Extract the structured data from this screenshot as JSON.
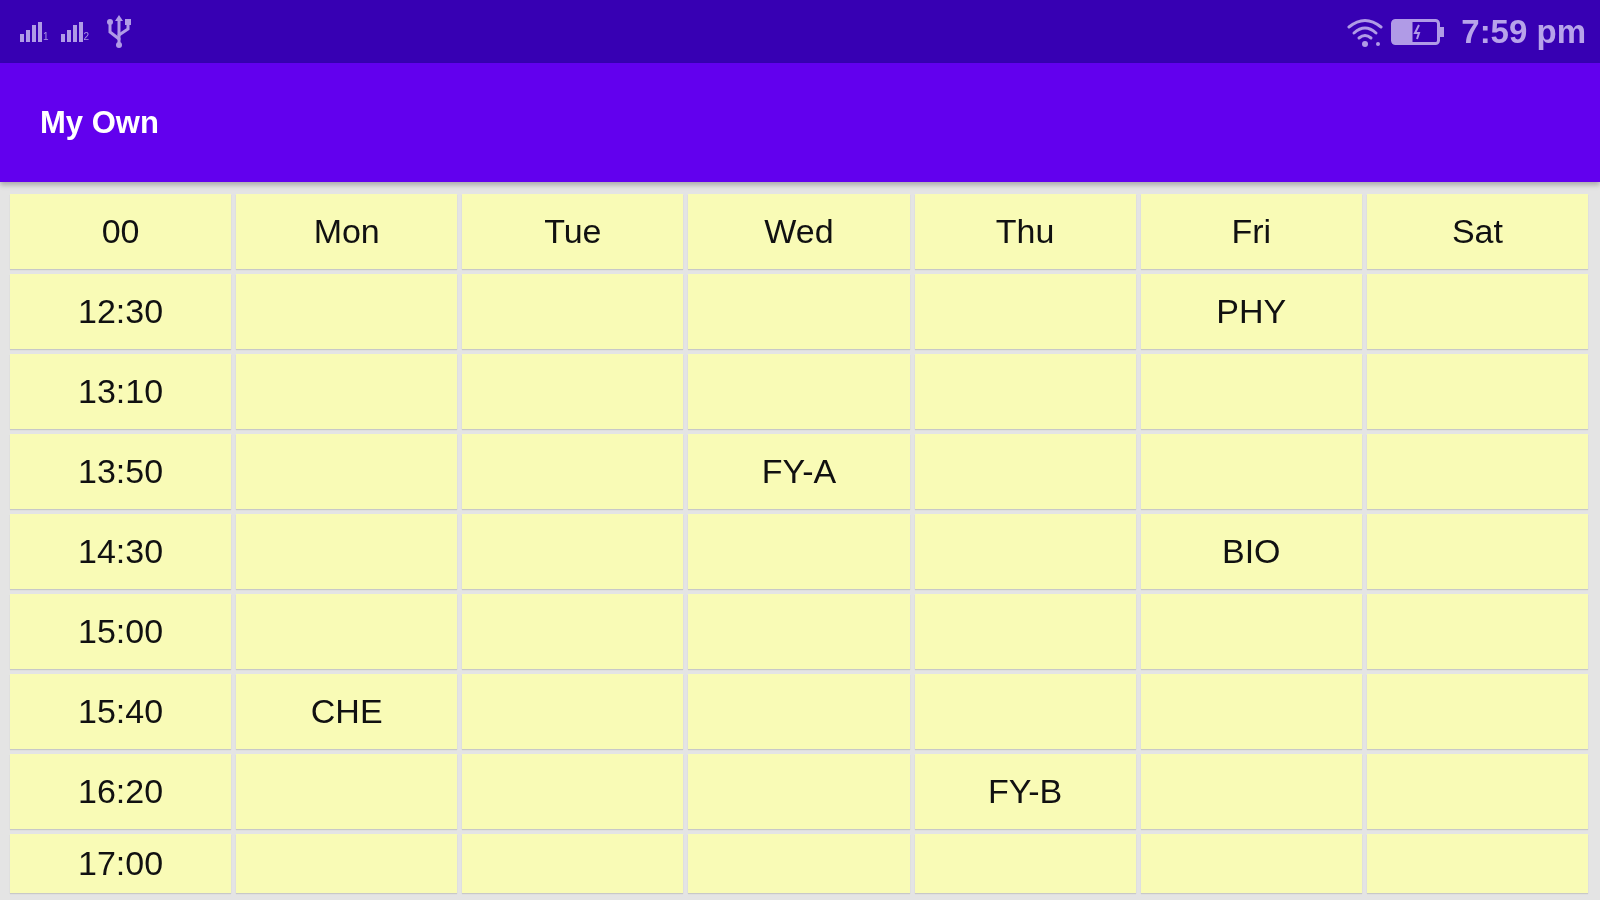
{
  "status_bar": {
    "sim_labels": [
      "1",
      "2"
    ],
    "time": "7:59 pm"
  },
  "app_bar": {
    "title": "My Own"
  },
  "table": {
    "columns": [
      "00",
      "Mon",
      "Tue",
      "Wed",
      "Thu",
      "Fri",
      "Sat"
    ],
    "rows": [
      [
        "12:30",
        "",
        "",
        "",
        "",
        "PHY",
        ""
      ],
      [
        "13:10",
        "",
        "",
        "",
        "",
        "",
        ""
      ],
      [
        "13:50",
        "",
        "",
        "FY-A",
        "",
        "",
        ""
      ],
      [
        "14:30",
        "",
        "",
        "",
        "",
        "BIO",
        ""
      ],
      [
        "15:00",
        "",
        "",
        "",
        "",
        "",
        ""
      ],
      [
        "15:40",
        "CHE",
        "",
        "",
        "",
        "",
        ""
      ],
      [
        "16:20",
        "",
        "",
        "",
        "FY-B",
        "",
        ""
      ],
      [
        "17:00",
        "",
        "",
        "",
        "",
        "",
        ""
      ]
    ]
  }
}
